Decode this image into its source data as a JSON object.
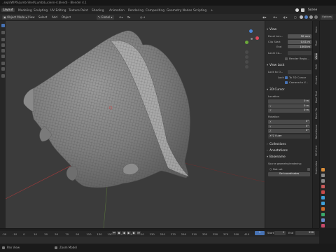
{
  "window": {
    "title": "..sep\\\\WIPS\\Lumb-Shell\\Lumb\\Lucienn-4.blend) - Blender 4.1"
  },
  "workspaces": {
    "tabs": [
      "Layout",
      "Modeling",
      "Sculpting",
      "UV Editing",
      "Texture Paint",
      "Shading",
      "Animation",
      "Rendering",
      "Compositing",
      "Geometry Nodes",
      "Scripting"
    ],
    "active_index": 0,
    "scene_label": "Scene"
  },
  "header": {
    "mode": "Object Mode",
    "view_menu": "View",
    "select_menu": "Select",
    "add_menu": "Add",
    "object_menu": "Object",
    "orientation": "Global",
    "options": "Options"
  },
  "view_panel": {
    "view_title": "View",
    "focal_label": "Focal Len...",
    "focal_value": "50 mm",
    "clip_start_label": "Clip Start",
    "clip_start_value": "0.01 m",
    "clip_end_label": "End",
    "clip_end_value": "1000 m",
    "local_cam_label": "Local Ca...",
    "render_region_label": "Render Regio...",
    "view_lock_title": "View Lock",
    "lock_object_label": "Lock to O...",
    "lock_label": "Lock",
    "lock_3d_cursor": "To 3D Cursor",
    "lock_camera": "Camera to V...",
    "cursor_title": "3D Cursor",
    "location_label": "Location",
    "loc": [
      {
        "axis": "X",
        "value": "0 m"
      },
      {
        "axis": "Y",
        "value": "0 m"
      },
      {
        "axis": "Z",
        "value": "0 m"
      }
    ],
    "rotation_label": "Rotation",
    "rot": [
      {
        "axis": "X",
        "value": "0°"
      },
      {
        "axis": "Y",
        "value": "0°"
      },
      {
        "axis": "Z",
        "value": "0°"
      }
    ],
    "rot_mode": "XYZ Euler",
    "collections_title": "Collections",
    "annotations_title": "Annotations",
    "bakename_title": "Bakename",
    "bakename_sub": "Source geometry/rendering:",
    "not_set": "Not set",
    "get_coords_btn": "Get coordinates"
  },
  "n_tabs": [
    "Item",
    "Tool",
    "View",
    "Edit",
    "Create",
    "Bool Tool",
    "Mesh Fix",
    "BakeName",
    "3D Print",
    "Sketchfab"
  ],
  "n_tab_active": 2,
  "timeline": {
    "ticks": [
      "-30",
      "-10",
      "0",
      "10",
      "30",
      "50",
      "70",
      "90",
      "110",
      "130",
      "150",
      "170",
      "190",
      "210",
      "230",
      "250",
      "270",
      "290",
      "310",
      "330",
      "350",
      "370",
      "390",
      "410"
    ],
    "current_frame": "1",
    "start_label": "Start",
    "start": "1",
    "end_label": "End",
    "end": "250"
  },
  "status": {
    "left": "Pan View",
    "mid": "Zoom Model",
    "right": ""
  },
  "colors": {
    "accent": "#4772b3",
    "mesh": "#8a8a8a",
    "viewport_bg": "#3b3b3b"
  }
}
